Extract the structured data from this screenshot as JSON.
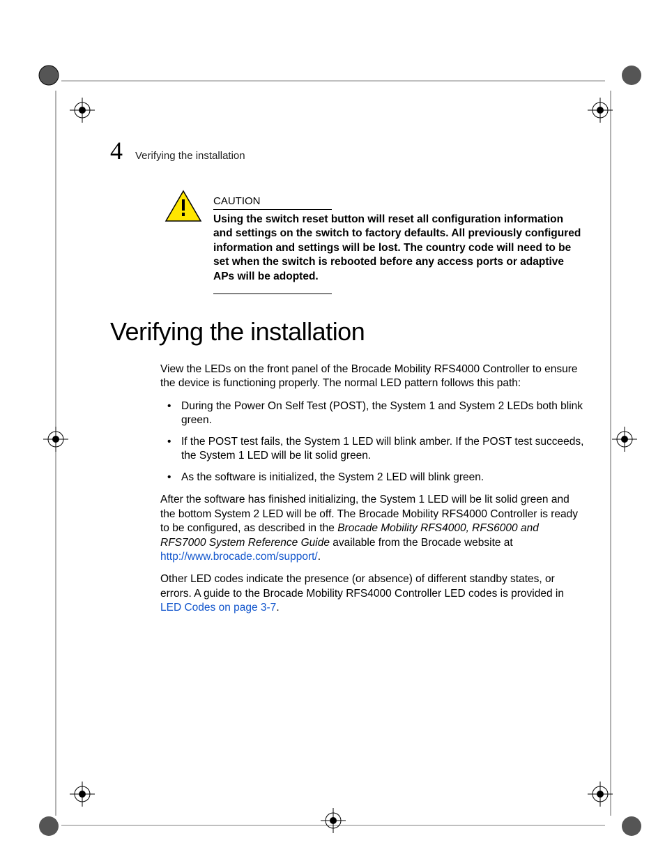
{
  "runhead": {
    "number": "4",
    "text": "Verifying the installation"
  },
  "caution": {
    "label": "CAUTION",
    "text": "Using the switch reset button will reset all configuration information and settings on the switch to factory defaults. All previously configured information and settings will be lost. The country code will need to be set when the switch is rebooted before any access ports or adaptive APs will be adopted."
  },
  "heading": "Verifying the installation",
  "body": {
    "intro": "View the LEDs on the front panel of the Brocade Mobility RFS4000 Controller to ensure the device is functioning properly. The normal LED pattern follows this path:",
    "bullets": [
      "During the Power On Self Test (POST), the System 1 and System 2 LEDs both blink green.",
      "If the POST test fails, the System 1 LED will blink amber. If the POST test succeeds, the System 1 LED will be lit solid green.",
      "As the software is initialized, the System 2 LED will blink green."
    ],
    "after_pre": "After the software has finished initializing, the System 1 LED will be lit solid green and the bottom System 2 LED will be off. The Brocade Mobility RFS4000 Controller is ready to be configured, as described in the ",
    "after_italic": "Brocade Mobility RFS4000, RFS6000 and RFS7000 System Reference Guide",
    "after_post": " available from the Brocade website at ",
    "after_link": "http://www.brocade.com/support/",
    "after_period": ".",
    "other_pre": "Other LED codes indicate the presence (or absence) of different standby states, or errors. A guide to the Brocade Mobility RFS4000 Controller LED codes is provided in ",
    "other_link": "LED Codes on page 3-7",
    "other_period": "."
  }
}
